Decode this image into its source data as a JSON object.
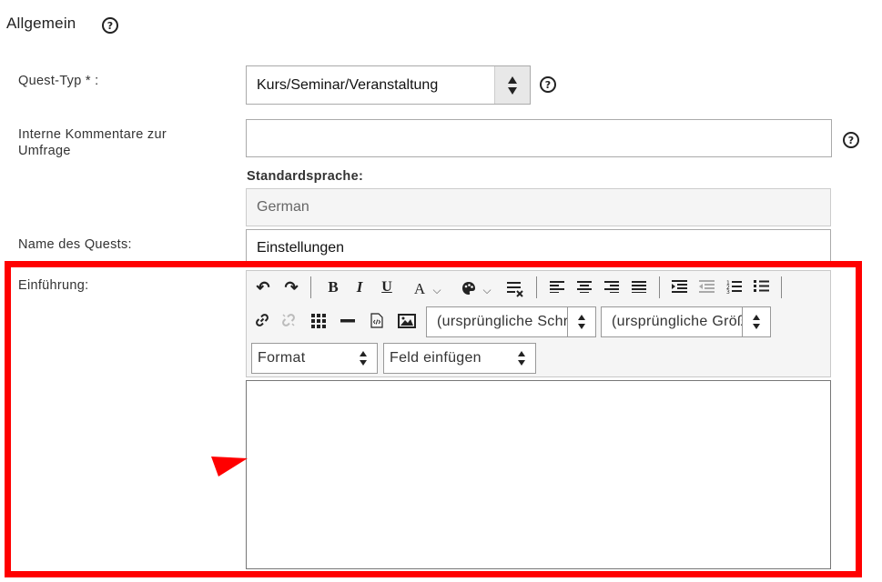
{
  "section": {
    "title": "Allgemein",
    "help_icon": "?"
  },
  "fields": {
    "quest_type": {
      "label": "Quest-Typ * :",
      "value": "Kurs/Seminar/Veranstaltung"
    },
    "internal_comments": {
      "label": "Interne Kommentare zur Umfrage",
      "value": ""
    },
    "standard_language": {
      "label": "Standardsprache:",
      "value": "German"
    },
    "quest_name": {
      "label": "Name des Quests:",
      "value": "Einstellungen"
    },
    "introduction": {
      "label": "Einführung:"
    }
  },
  "editor": {
    "buttons": {
      "undo": "↶",
      "redo": "↷",
      "bold": "B",
      "italic": "I",
      "underline": "U",
      "font_color": "A",
      "chevron": "⌵"
    },
    "font_family": "(ursprüngliche Schriftart)",
    "font_size": "(ursprüngliche Größe)",
    "format": "Format",
    "insert_field": "Feld einfügen"
  },
  "colors": {
    "highlight": "#ff0000",
    "toolbar_bg": "#f5f5f5",
    "readonly_bg": "#f5f5f5"
  }
}
